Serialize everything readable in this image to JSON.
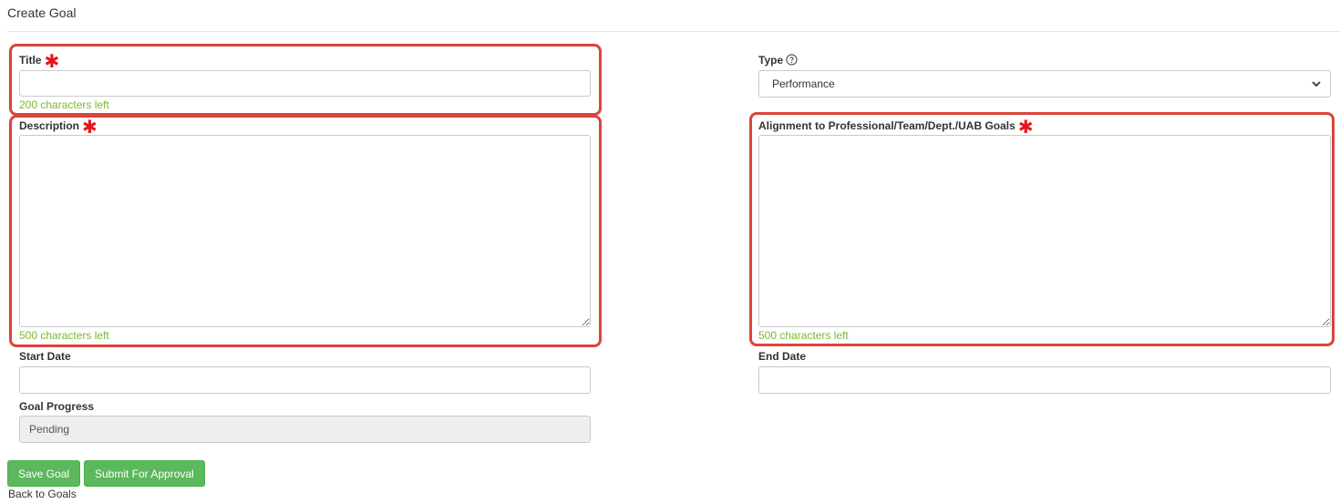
{
  "page": {
    "title": "Create Goal"
  },
  "form": {
    "title": {
      "label": "Title",
      "value": "",
      "counter": "200 characters left"
    },
    "type": {
      "label": "Type",
      "help_icon": "question-circle-icon",
      "selected": "Performance"
    },
    "description": {
      "label": "Description",
      "value": "",
      "counter": "500 characters left"
    },
    "alignment": {
      "label": "Alignment to Professional/Team/Dept./UAB Goals",
      "value": "",
      "counter": "500 characters left"
    },
    "start_date": {
      "label": "Start Date",
      "value": ""
    },
    "end_date": {
      "label": "End Date",
      "value": ""
    },
    "progress": {
      "label": "Goal Progress",
      "value": "Pending"
    }
  },
  "actions": {
    "save_label": "Save Goal",
    "submit_label": "Submit For Approval",
    "back_label": "Back to Goals"
  },
  "colors": {
    "highlight": "#d9453a",
    "required": "#e8141d",
    "counter": "#7cb82f",
    "button": "#5cb85c"
  }
}
